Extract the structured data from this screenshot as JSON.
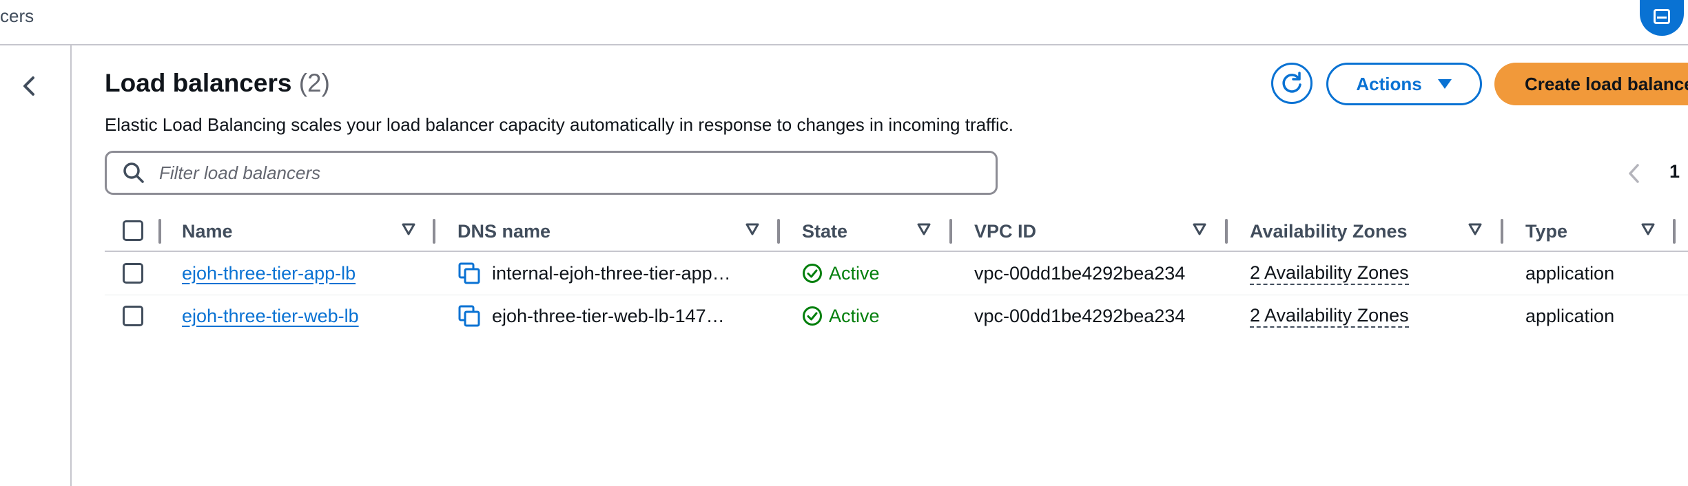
{
  "header": {
    "breadcrumb": "cers"
  },
  "page": {
    "title": "Load balancers",
    "count": "(2)",
    "description": "Elastic Load Balancing scales your load balancer capacity automatically in response to changes in incoming traffic."
  },
  "buttons": {
    "actions": "Actions",
    "create": "Create load balancer"
  },
  "filter": {
    "placeholder": "Filter load balancers"
  },
  "pagination": {
    "current_page": "1"
  },
  "table": {
    "columns": [
      "Name",
      "DNS name",
      "State",
      "VPC ID",
      "Availability Zones",
      "Type"
    ],
    "rows": [
      {
        "name": "ejoh-three-tier-app-lb",
        "dns": "internal-ejoh-three-tier-app…",
        "state": "Active",
        "vpc": "vpc-00dd1be4292bea234",
        "az": "2 Availability Zones",
        "type": "application"
      },
      {
        "name": "ejoh-three-tier-web-lb",
        "dns": "ejoh-three-tier-web-lb-147…",
        "state": "Active",
        "vpc": "vpc-00dd1be4292bea234",
        "az": "2 Availability Zones",
        "type": "application"
      }
    ]
  },
  "colors": {
    "accent": "#0972d3",
    "primary_button": "#f1993a",
    "success": "#037f0c"
  },
  "icons": [
    "chevron-left-icon",
    "refresh-icon",
    "caret-down-icon",
    "search-icon",
    "copy-icon",
    "check-circle-icon",
    "sort-icon"
  ]
}
